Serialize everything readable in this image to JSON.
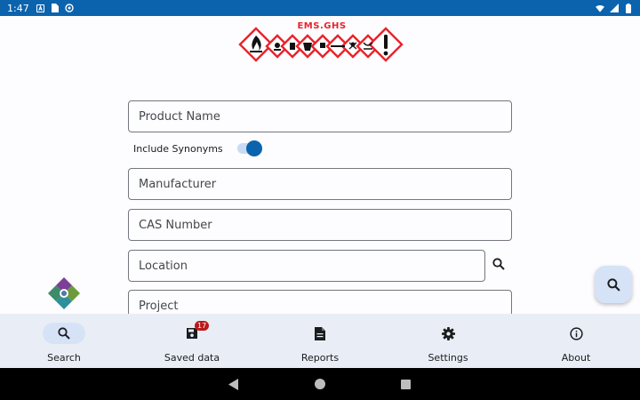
{
  "status_bar": {
    "time": "1:47",
    "left_icons": [
      "a-icon",
      "sim-icon",
      "sync-icon"
    ],
    "right_icons": [
      "wifi-icon",
      "signal-icon",
      "battery-icon"
    ]
  },
  "logo": {
    "text": "EMS.GHS",
    "color": "#e9232b"
  },
  "form": {
    "product_name": {
      "value": "",
      "placeholder": "Product Name"
    },
    "include_synonyms": {
      "label": "Include Synonyms",
      "checked": true
    },
    "manufacturer": {
      "value": "",
      "placeholder": "Manufacturer"
    },
    "cas_number": {
      "value": "",
      "placeholder": "CAS Number"
    },
    "location": {
      "value": "",
      "placeholder": "Location"
    },
    "project": {
      "value": "",
      "placeholder": "Project"
    }
  },
  "fab": {
    "icon": "search-icon"
  },
  "bottom_nav": {
    "items": [
      {
        "label": "Search",
        "icon": "search-icon",
        "active": true
      },
      {
        "label": "Saved data",
        "icon": "save-icon",
        "badge": "17"
      },
      {
        "label": "Reports",
        "icon": "document-icon"
      },
      {
        "label": "Settings",
        "icon": "gear-icon"
      },
      {
        "label": "About",
        "icon": "info-icon"
      }
    ]
  },
  "colors": {
    "status_bar": "#0b63ad",
    "accent": "#0b63ad",
    "nav_background": "#e9eef6",
    "badge": "#ba1a1a"
  }
}
